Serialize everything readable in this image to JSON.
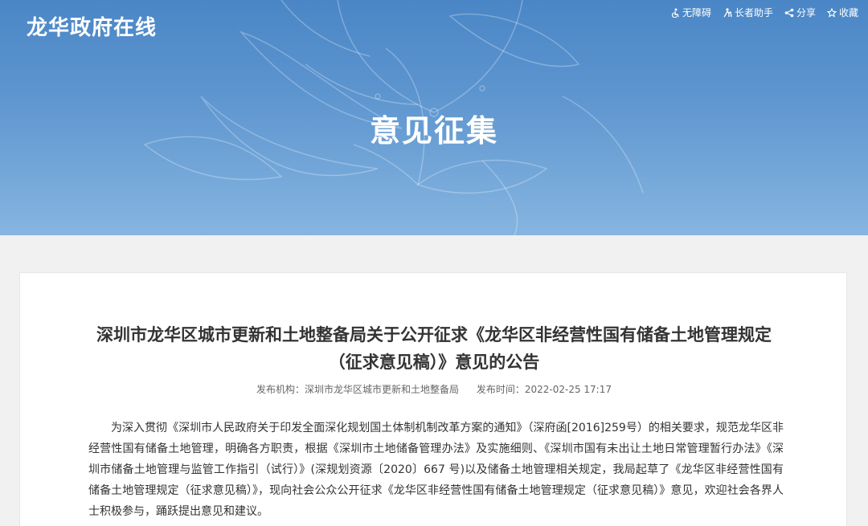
{
  "header": {
    "site_title": "龙华政府在线",
    "tools": [
      {
        "label": "无障碍",
        "icon": "accessibility-icon"
      },
      {
        "label": "长者助手",
        "icon": "elder-assist-icon"
      },
      {
        "label": "分享",
        "icon": "share-icon"
      },
      {
        "label": "收藏",
        "icon": "star-icon"
      }
    ]
  },
  "banner": {
    "heading": "意见征集"
  },
  "article": {
    "title": "深圳市龙华区城市更新和土地整备局关于公开征求《龙华区非经营性国有储备土地管理规定（征求意见稿）》意见的公告",
    "publisher_label": "发布机构：",
    "publisher": "深圳市龙华区城市更新和土地整备局",
    "time_label": "发布时间：",
    "time": "2022-02-25 17:17",
    "body": "为深入贯彻《深圳市人民政府关于印发全面深化规划国土体制机制改革方案的通知》（深府函[2016]259号）的相关要求，规范龙华区非经营性国有储备土地管理，明确各方职责，根据《深圳市土地储备管理办法》及实施细则、《深圳市国有未出让土地日常管理暂行办法》《深圳市储备土地管理与监管工作指引（试行）》(深规划资源〔2020〕667 号)以及储备土地管理相关规定，我局起草了《龙华区非经营性国有储备土地管理规定（征求意见稿）》，现向社会公众公开征求《龙华区非经营性国有储备土地管理规定（征求意见稿）》意见，欢迎社会各界人士积极参与，踊跃提出意见和建议。"
  },
  "colors": {
    "banner_top": "#4a86c6",
    "banner_bottom": "#86b5e0",
    "page_bg": "#f1f1f1",
    "text": "#333333",
    "meta": "#666666"
  }
}
